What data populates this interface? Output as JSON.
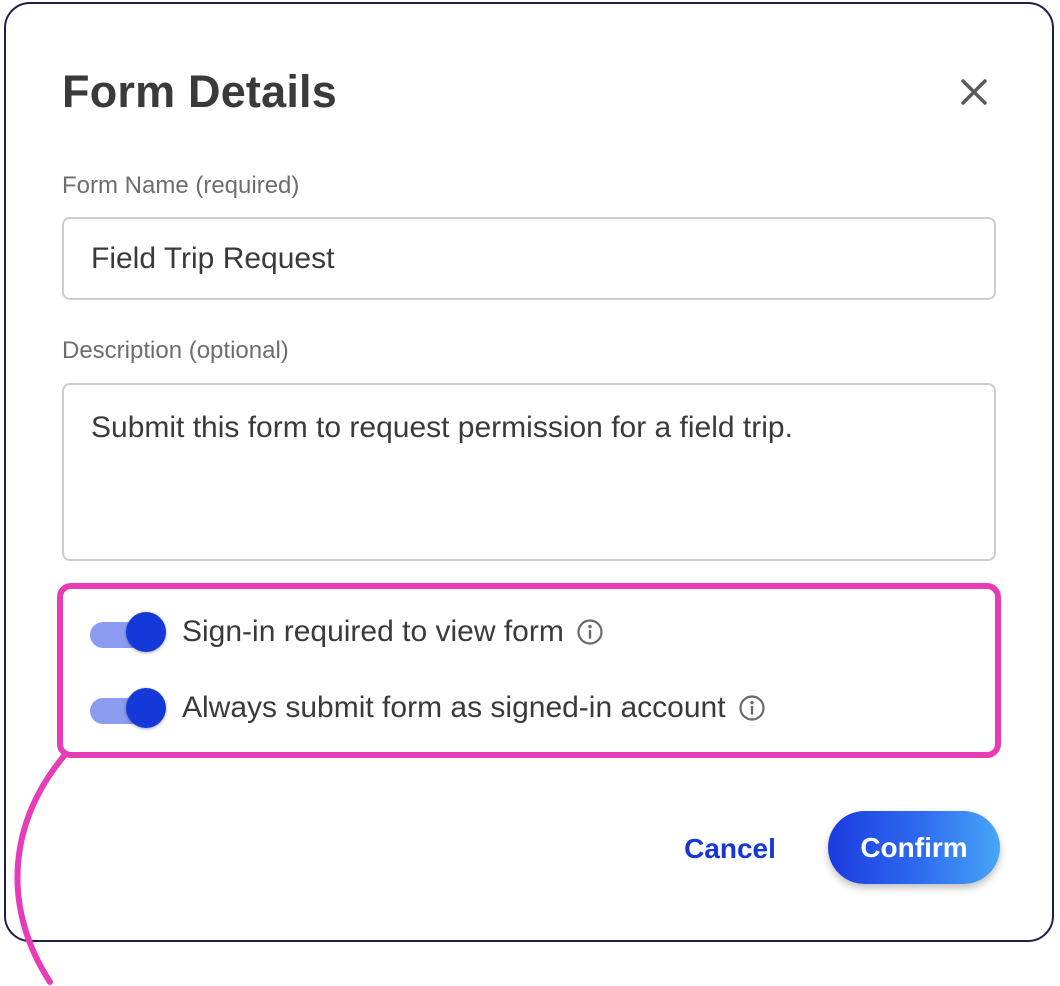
{
  "dialog": {
    "title": "Form Details",
    "close_icon": "close-icon"
  },
  "form_name": {
    "label": "Form Name (required)",
    "value": "Field Trip Request"
  },
  "description": {
    "label": "Description (optional)",
    "value": "Submit this form to request permission for a field trip."
  },
  "toggles": [
    {
      "label": "Sign-in required to view form",
      "on": true,
      "icon": "info-icon"
    },
    {
      "label": "Always submit form as signed-in account",
      "on": true,
      "icon": "info-icon"
    }
  ],
  "actions": {
    "cancel_label": "Cancel",
    "confirm_label": "Confirm"
  },
  "colors": {
    "accent": "#1438d9",
    "highlight": "#e83bb8",
    "toggle_track": "#8b9cf0",
    "confirm_gradient_end": "#48a6f7"
  }
}
